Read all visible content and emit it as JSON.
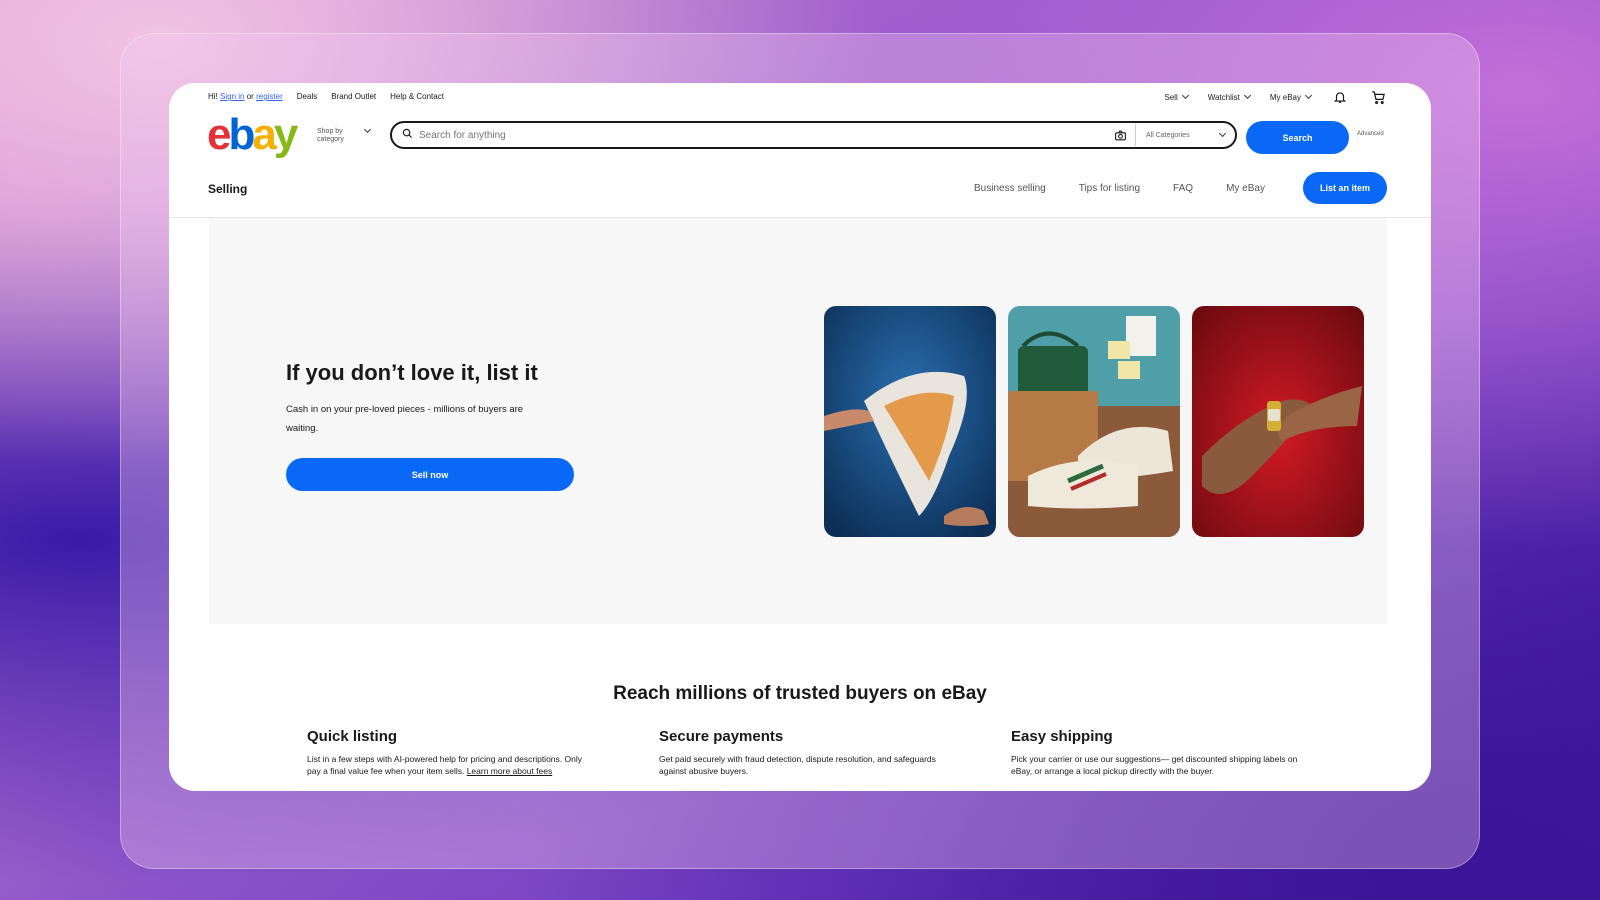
{
  "topbar": {
    "greeting_prefix": "Hi!",
    "sign_in": "Sign in",
    "or": "or",
    "register": "register",
    "links": [
      "Deals",
      "Brand Outlet",
      "Help & Contact"
    ],
    "sell": "Sell",
    "watchlist": "Watchlist",
    "my_ebay": "My eBay"
  },
  "header": {
    "logo": {
      "e": "e",
      "b": "b",
      "a": "a",
      "y": "y"
    },
    "shop_by_category": "Shop by category",
    "search_placeholder": "Search for anything",
    "category_select": "All Categories",
    "search_button": "Search",
    "advanced": "Advanced"
  },
  "selling_nav": {
    "title": "Selling",
    "links": [
      "Business selling",
      "Tips for listing",
      "FAQ",
      "My eBay"
    ],
    "list_button": "List an item"
  },
  "hero": {
    "title": "If you don’t love it, list it",
    "subtitle": "Cash in on your pre-loved pieces - millions of buyers are waiting.",
    "cta": "Sell now",
    "colors": {
      "card1": "#1b4f86",
      "card2": "#4a9aa3",
      "card3": "#c1121f"
    }
  },
  "reach": {
    "title": "Reach millions of trusted buyers on eBay",
    "features": [
      {
        "title": "Quick listing",
        "text": "List in a few steps with AI-powered help for pricing and descriptions. Only pay a final value fee when your item sells. ",
        "link": "Learn more about fees"
      },
      {
        "title": "Secure payments",
        "text": "Get paid securely with fraud detection, dispute resolution, and safeguards against abusive buyers."
      },
      {
        "title": "Easy shipping",
        "text": "Pick your carrier or use our suggestions— get discounted shipping labels on eBay, or arrange a local pickup directly with the buyer."
      }
    ]
  },
  "accent_color": "#0968f6"
}
